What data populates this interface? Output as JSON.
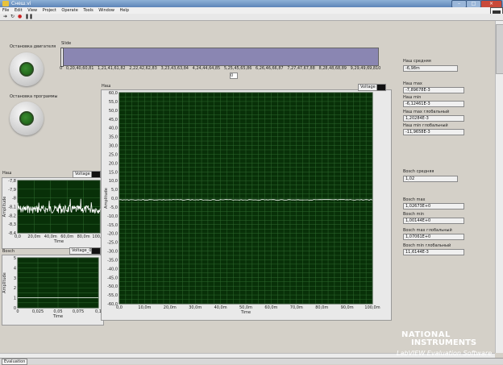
{
  "window": {
    "title": "Снеш.vi"
  },
  "menu": [
    "File",
    "Edit",
    "View",
    "Project",
    "Operate",
    "Tools",
    "Window",
    "Help"
  ],
  "buttons": {
    "engine_stop_label": "Остановка двигателя",
    "program_stop_label": "Остановка программы"
  },
  "slide": {
    "label": "Slide",
    "ticks": [
      "0",
      "0,2",
      "0,4",
      "0,6",
      "0,8",
      "1",
      "1,2",
      "1,4",
      "1,6",
      "1,8",
      "2",
      "2,2",
      "2,4",
      "2,6",
      "2,8",
      "3",
      "3,2",
      "3,4",
      "3,6",
      "3,8",
      "4",
      "4,2",
      "4,4",
      "4,6",
      "4,8",
      "5",
      "5,2",
      "5,4",
      "5,6",
      "5,8",
      "6",
      "6,2",
      "6,4",
      "6,6",
      "6,8",
      "7",
      "7,2",
      "7,4",
      "7,6",
      "7,8",
      "8",
      "8,2",
      "8,4",
      "8,6",
      "8,8",
      "9",
      "9,2",
      "9,4",
      "9,6",
      "9,8",
      "10"
    ],
    "value_text": "0"
  },
  "indicators": {
    "nash_avg": {
      "label": "Наш средняя",
      "value": "-6,98m"
    },
    "nash_max": {
      "label": "Наш max",
      "value": "-7,89678E-3"
    },
    "nash_min": {
      "label": "Наш min",
      "value": "-6,12461E-3"
    },
    "nash_max_global": {
      "label": "Наш max глобальный",
      "value": "1,20284E-3"
    },
    "nash_min_global": {
      "label": "Наш min глобальный",
      "value": "-11,9658E-3"
    },
    "bosch_avg": {
      "label": "Bosch средняя",
      "value": "1,02"
    },
    "bosch_max": {
      "label": "Bosch max",
      "value": "1,02673E+0"
    },
    "bosch_min": {
      "label": "Bosch min",
      "value": "1,00144E+0"
    },
    "bosch_max_global": {
      "label": "Bosch max глобальный",
      "value": "1,07061E+0"
    },
    "bosch_min_global": {
      "label": "Bosch min глобальный",
      "value": "11,6144E-3"
    }
  },
  "graph_nash_small": {
    "label": "Наш",
    "legend": "Voltage",
    "xlabel": "Time",
    "ylabel": "Amplitude",
    "yticks": [
      "-7,8",
      "-7,9",
      "-8",
      "-8,1",
      "-8,2",
      "-8,3",
      "-8,4"
    ],
    "xticks": [
      "0,0",
      "20,0m",
      "40,0m",
      "60,0m",
      "80,0m",
      "100,0m"
    ]
  },
  "graph_bosch": {
    "label": "Bosch",
    "legend": "Voltage_0",
    "xlabel": "Time",
    "ylabel": "Amplitude",
    "yticks": [
      "5",
      "4",
      "3",
      "2",
      "1",
      "0"
    ],
    "xticks": [
      "0",
      "0,025",
      "0,05",
      "0,075",
      "0,1"
    ]
  },
  "graph_main": {
    "label": "Наш",
    "legend": "Voltage",
    "xlabel": "Time",
    "ylabel": "Amplitude",
    "yticks": [
      "60,0",
      "55,0",
      "50,0",
      "45,0",
      "40,0",
      "35,0",
      "30,0",
      "25,0",
      "20,0",
      "15,0",
      "10,0",
      "5,0",
      "0,0",
      "-5,0",
      "-10,0",
      "-15,0",
      "-20,0",
      "-25,0",
      "-30,0",
      "-35,0",
      "-40,0",
      "-45,0",
      "-50,0",
      "-55,0",
      "-60,0"
    ],
    "xticks": [
      "0,0",
      "10,0m",
      "20,0m",
      "30,0m",
      "40,0m",
      "50,0m",
      "60,0m",
      "70,0m",
      "80,0m",
      "90,0m",
      "100,0m"
    ]
  },
  "branding": {
    "line1": "NATIONAL",
    "line2": "INSTRUMENTS",
    "line3": "LabVIEW Evaluation Software"
  },
  "status": {
    "mode": "Evaluation"
  }
}
